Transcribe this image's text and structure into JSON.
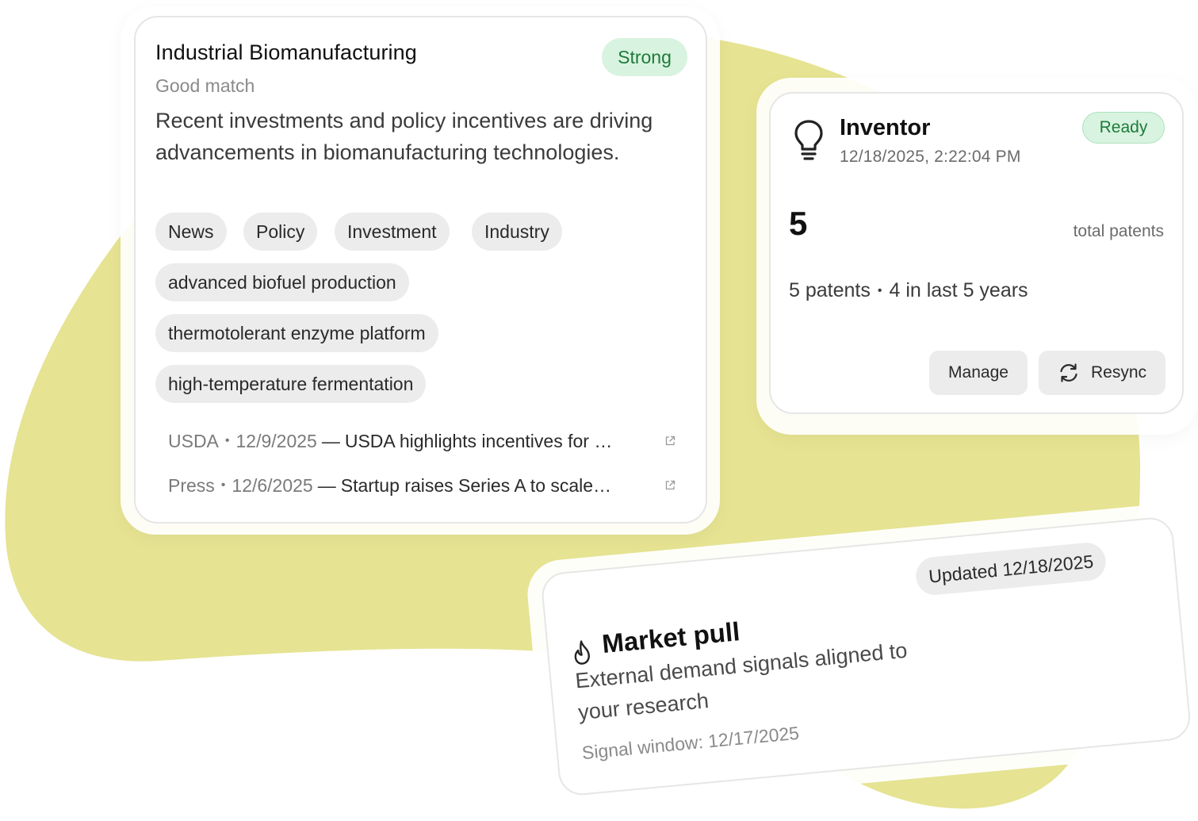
{
  "theme": {
    "accent_yellow": "#e6e392",
    "success_bg": "#d8f3df",
    "success_text": "#1e7a3b",
    "chip_bg": "#ececec"
  },
  "match_card": {
    "title": "Industrial Biomanufacturing",
    "subtitle": "Good match",
    "badge": "Strong",
    "description": "Recent investments and policy incentives are driving advancements in biomanufacturing technologies.",
    "tags": [
      "News",
      "Policy",
      "Investment",
      "Industry"
    ],
    "topics": [
      "advanced biofuel production",
      "thermotolerant enzyme platform",
      "high-temperature fermentation"
    ],
    "sources": [
      {
        "source": "USDA",
        "date": "12/9/2025",
        "headline": "USDA highlights incentives for …",
        "icon": "external-link-icon"
      },
      {
        "source": "Press",
        "date": "12/6/2025",
        "headline": "Startup raises Series A to scale…",
        "icon": "external-link-icon"
      }
    ]
  },
  "inventor_card": {
    "icon": "lightbulb-icon",
    "title": "Inventor",
    "timestamp": "12/18/2025, 2:22:04 PM",
    "badge": "Ready",
    "total_value": "5",
    "total_label": "total patents",
    "summary_patents": "5 patents",
    "summary_recent": "4 in last 5 years",
    "manage_label": "Manage",
    "resync_label": "Resync",
    "resync_icon": "refresh-icon"
  },
  "market_card": {
    "icon": "flame-icon",
    "title": "Market pull",
    "description": "External demand signals aligned to your research",
    "signal_window": "Signal window: 12/17/2025",
    "badge": "Updated 12/18/2025"
  }
}
